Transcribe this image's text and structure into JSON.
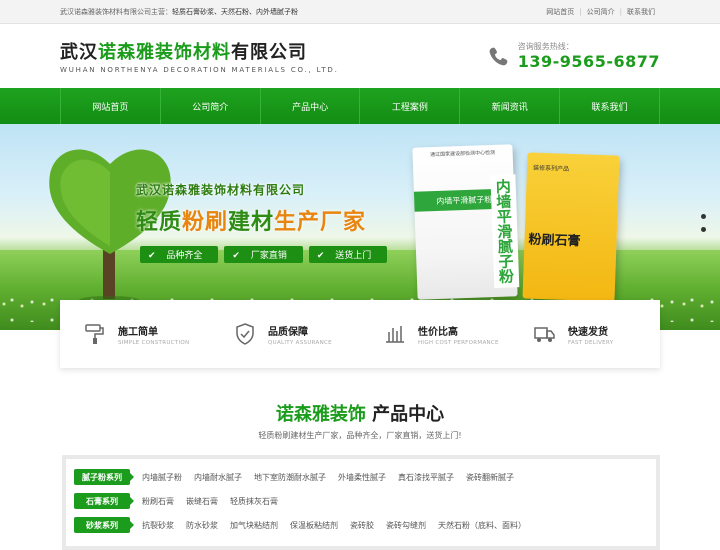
{
  "topbar": {
    "intro_prefix": "武汉诺森雅装饰材料有限公司主营：",
    "intro_products": "轻质石膏砂浆、天然石粉、内外墙腻子粉",
    "links": [
      "网站首页",
      "公司简介",
      "联系我们"
    ]
  },
  "header": {
    "logo_cn_a": "武汉",
    "logo_cn_b": "诺森雅装饰材料",
    "logo_cn_c": "有限公司",
    "logo_en": "WUHAN NORTHENYA DECORATION MATERIALS CO., LTD.",
    "hotline_label": "咨询服务热线：",
    "hotline_number": "139-9565-6877"
  },
  "nav": [
    "网站首页",
    "公司简介",
    "产品中心",
    "工程案例",
    "新闻资讯",
    "联系我们"
  ],
  "banner": {
    "company": "武汉诺森雅装饰材料有限公司",
    "slogan_a": "轻质",
    "slogan_b": "粉刷",
    "slogan_c": "建材",
    "slogan_d": "生产厂家",
    "tags": [
      "品种齐全",
      "厂家直销",
      "送货上门"
    ],
    "bag1_top": "通过国家建设部检测中心检测",
    "bag1_strip": "内墙平滑腻子粉",
    "bag1_vertical": "内墙平滑腻子粉",
    "bag2_top": "装修系列产品",
    "bag2_big": "粉刷石膏"
  },
  "features": [
    {
      "icon": "paint-roller-icon",
      "title": "施工简单",
      "sub": "SIMPLE CONSTRUCTION"
    },
    {
      "icon": "shield-check-icon",
      "title": "品质保障",
      "sub": "QUALITY ASSURANCE"
    },
    {
      "icon": "value-hand-icon",
      "title": "性价比高",
      "sub": "HIGH COST PERFORMANCE"
    },
    {
      "icon": "delivery-truck-icon",
      "title": "快速发货",
      "sub": "FAST DELIVERY"
    }
  ],
  "product_center": {
    "title_a": "诺森雅装饰",
    "title_b": "产品中心",
    "subtitle": "轻质粉刷建材生产厂家，品种齐全，厂家直销，送货上门!"
  },
  "categories": [
    {
      "label": "腻子粉系列",
      "items": [
        "内墙腻子粉",
        "内墙耐水腻子",
        "地下室防潮耐水腻子",
        "外墙柔性腻子",
        "真石漆找平腻子",
        "瓷砖翻新腻子"
      ]
    },
    {
      "label": "石膏系列",
      "items": [
        "粉刷石膏",
        "嵌缝石膏",
        "轻质抹灰石膏"
      ]
    },
    {
      "label": "砂浆系列",
      "items": [
        "抗裂砂浆",
        "防水砂浆",
        "加气块粘结剂",
        "保温板粘结剂",
        "瓷砖胶",
        "瓷砖勾缝剂",
        "天然石粉（底料、面料）"
      ]
    }
  ],
  "colors": {
    "brand_green": "#1c9c1c",
    "accent_orange": "#e8850e"
  }
}
